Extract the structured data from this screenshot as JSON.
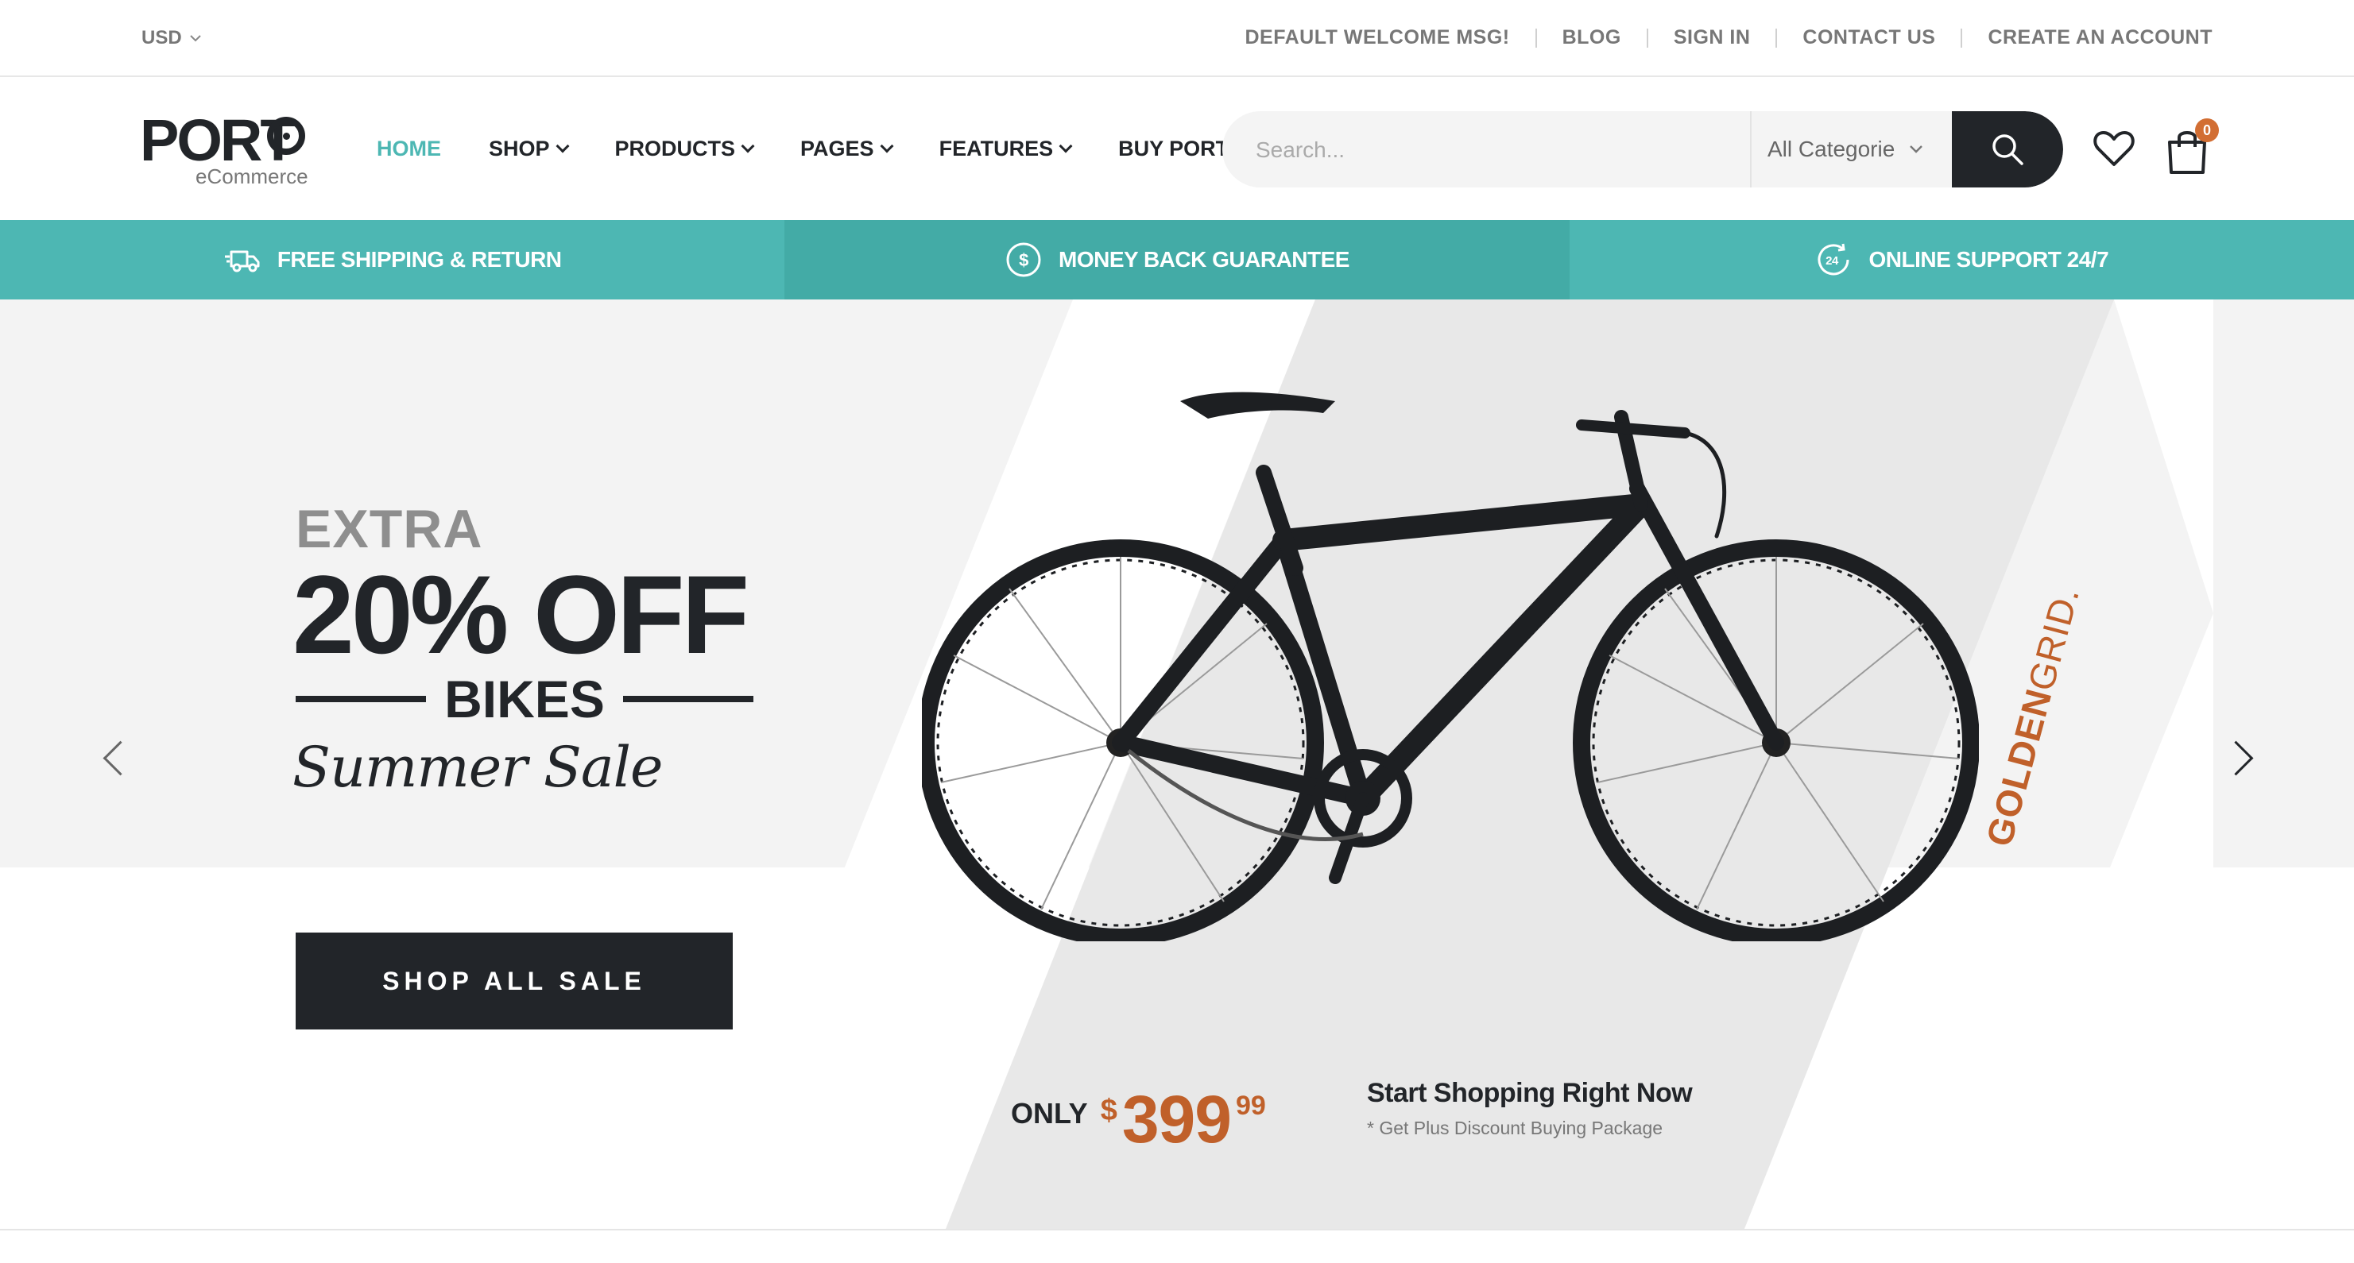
{
  "topbar": {
    "currency": "USD",
    "links": [
      "DEFAULT WELCOME MSG!",
      "BLOG",
      "SIGN IN",
      "CONTACT US",
      "CREATE AN ACCOUNT"
    ]
  },
  "header": {
    "logo": {
      "word": "PORT",
      "sub": "eCommerce"
    },
    "nav": [
      {
        "label": "HOME",
        "active": true,
        "dropdown": false
      },
      {
        "label": "SHOP",
        "active": false,
        "dropdown": true
      },
      {
        "label": "PRODUCTS",
        "active": false,
        "dropdown": true
      },
      {
        "label": "PAGES",
        "active": false,
        "dropdown": true
      },
      {
        "label": "FEATURES",
        "active": false,
        "dropdown": true
      },
      {
        "label": "BUY PORTO!",
        "active": false,
        "dropdown": false
      }
    ],
    "search": {
      "placeholder": "Search...",
      "category": "All Categorie"
    },
    "cart_count": "0"
  },
  "features": [
    {
      "icon": "truck-icon",
      "label": "FREE SHIPPING & RETURN"
    },
    {
      "icon": "dollar-circle-icon",
      "label": "MONEY BACK GUARANTEE"
    },
    {
      "icon": "support-24-icon",
      "label": "ONLINE SUPPORT 24/7"
    }
  ],
  "hero": {
    "extra": "EXTRA",
    "headline": "20% OFF",
    "product": "BIKES",
    "tagline": "Summer Sale",
    "cta": "SHOP ALL SALE",
    "price": {
      "prefix": "ONLY",
      "currency": "$",
      "main": "399",
      "cents": "99"
    },
    "promo_title": "Start Shopping Right Now",
    "promo_sub": "* Get Plus Discount Buying Package",
    "brand_bold": "GOLDEN",
    "brand_light": "GRID."
  },
  "colors": {
    "accent": "#4db7b3",
    "dark": "#222529",
    "price": "#c0602a",
    "badge": "#d26e33"
  }
}
